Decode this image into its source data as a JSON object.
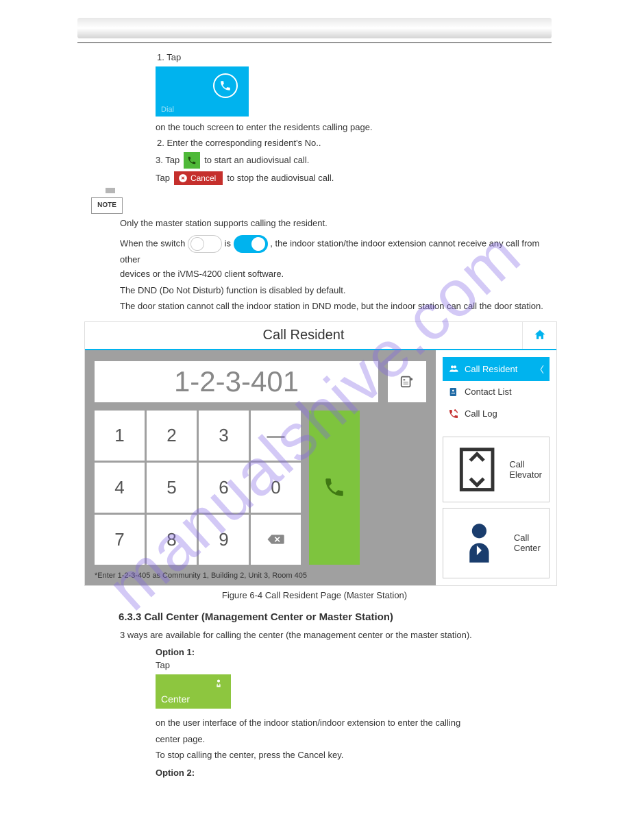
{
  "header": {
    "title": ""
  },
  "step1": {
    "line": "1.   Tap",
    "rest": "on the touch screen to enter the residents calling page."
  },
  "dialTile": {
    "label": "Dial"
  },
  "step2": {
    "prefix": "2.   Enter the corresponding resident's No.."
  },
  "step3": {
    "prefix": "3.   Tap",
    "mid": "to start an audiovisual call.",
    "tap2": "Tap",
    "mid2": "to stop the audiovisual call."
  },
  "cancelBtn": {
    "label": "Cancel"
  },
  "note": {
    "label": "NOTE",
    "line1": "Only the master station supports calling the resident."
  },
  "dnd": {
    "p1a": "When the switch ",
    "p1b": " is ",
    "p1c": " , the indoor station/the indoor extension cannot receive any call from other",
    "p2": "devices or the iVMS-4200 client software.",
    "p3": "The DND (Do Not Disturb) function is disabled by default.",
    "p4": "The door station cannot call the indoor station in DND mode, but the indoor station can call the door station."
  },
  "ui": {
    "title": "Call Resident",
    "displayValue": "1-2-3-401",
    "keys": [
      "1",
      "2",
      "3",
      "—",
      "4",
      "5",
      "6",
      "0",
      "7",
      "8",
      "9"
    ],
    "hint": "*Enter 1-2-3-405 as Community 1, Building 2, Unit 3, Room 405",
    "side": {
      "callResident": "Call Resident",
      "contactList": "Contact List",
      "callLog": "Call Log",
      "callElevator": "Call Elevator",
      "callCenter": "Call Center"
    }
  },
  "figCaption": "Figure 6-4 Call Resident Page (Master Station)",
  "section2": {
    "heading": "6.3.3 Call Center (Management Center or Master Station)",
    "p1": "3 ways are available for calling the center (the management center or the master station).",
    "option1": "Option 1:",
    "op1_a": "Tap",
    "op1_b": "on the user interface of the indoor station/indoor extension to enter the calling",
    "op1_c": "center page.",
    "centerLabel": "Center",
    "toStop": "To stop calling the center, press the Cancel key.",
    "option2": "Option 2:"
  }
}
